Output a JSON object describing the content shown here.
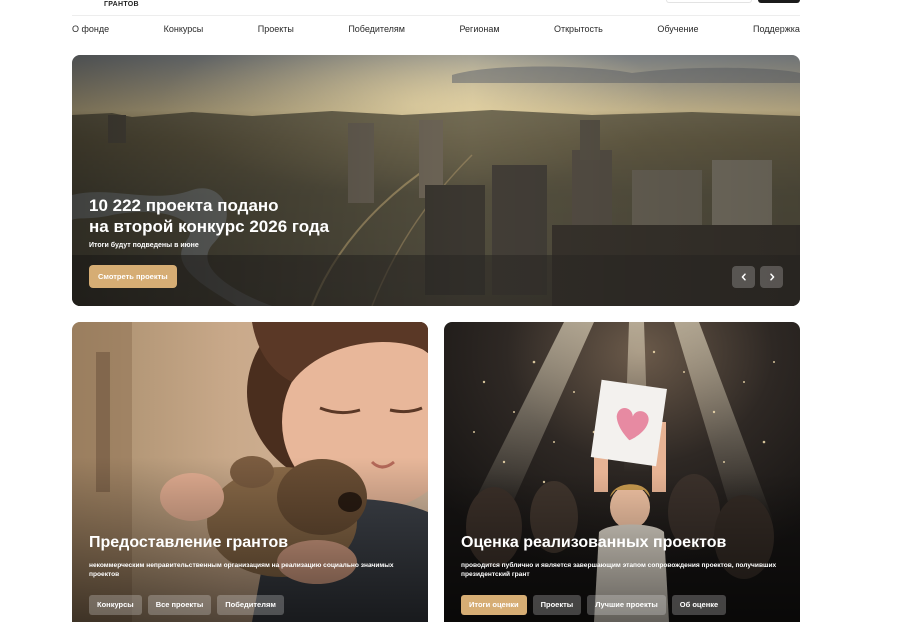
{
  "header": {
    "logo_text": "ГРАНТОВ"
  },
  "nav": {
    "items": [
      "О фонде",
      "Конкурсы",
      "Проекты",
      "Победителям",
      "Регионам",
      "Открытость",
      "Обучение",
      "Поддержка"
    ]
  },
  "hero": {
    "title_line1": "10 222 проекта подано",
    "title_line2": "на второй конкурс 2026 года",
    "subtitle": "Итоги будут подведены в июне",
    "cta_label": "Смотреть проекты",
    "prev_icon": "chevron-left-icon",
    "next_icon": "chevron-right-icon"
  },
  "cards": {
    "grants": {
      "title": "Предоставление грантов",
      "description": "некоммерческим неправительственным организациям на реализацию социально значимых проектов",
      "tags": [
        "Конкурсы",
        "Все проекты",
        "Победителям"
      ]
    },
    "evaluation": {
      "title": "Оценка реализованных проектов",
      "description": "проводится публично и является завершающим этапом сопровождения проектов, получивших президентский грант",
      "tags": [
        "Итоги оценки",
        "Проекты",
        "Лучшие проекты",
        "Об оценке"
      ]
    }
  },
  "colors": {
    "accent": "#d6ad74",
    "text": "#1d1d1f",
    "background": "#ffffff"
  }
}
